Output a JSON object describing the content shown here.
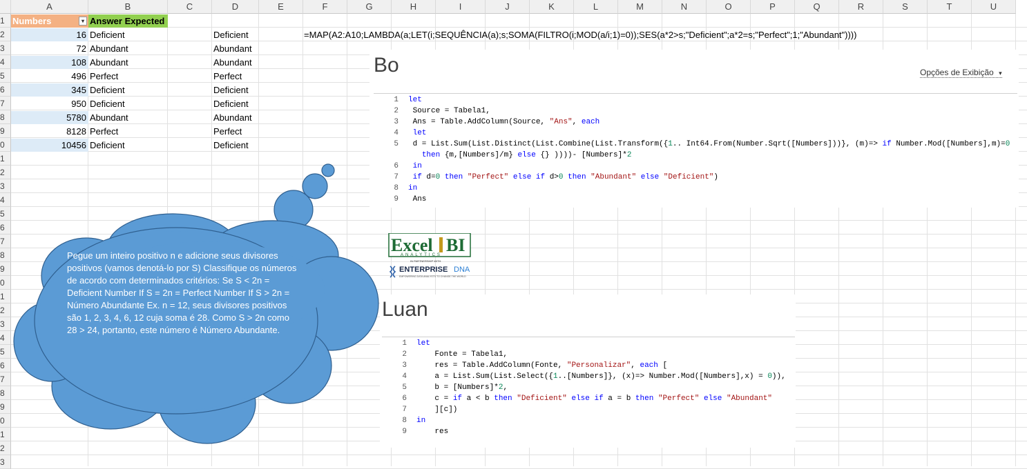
{
  "columns": [
    "A",
    "B",
    "C",
    "D",
    "E",
    "F",
    "G",
    "H",
    "I",
    "J",
    "K",
    "L",
    "M",
    "N",
    "O",
    "P",
    "Q",
    "R",
    "S",
    "T",
    "U"
  ],
  "rows": [
    "1",
    "2",
    "3",
    "4",
    "5",
    "6",
    "7",
    "8",
    "9",
    "0",
    "1",
    "2",
    "3",
    "4",
    "5",
    "6",
    "7",
    "8",
    "9",
    "0",
    "1",
    "2",
    "3",
    "4",
    "5",
    "6",
    "7",
    "8",
    "9",
    "0",
    "1",
    "2",
    "3"
  ],
  "table": {
    "header_a": "Numbers",
    "header_b": "Answer Expected",
    "filter_glyph": "▾",
    "rows": [
      {
        "n": "16",
        "b": "Deficient",
        "d": "Deficient"
      },
      {
        "n": "72",
        "b": "Abundant",
        "d": "Abundant"
      },
      {
        "n": "108",
        "b": "Abundant",
        "d": "Abundant"
      },
      {
        "n": "496",
        "b": "Perfect",
        "d": "Perfect"
      },
      {
        "n": "345",
        "b": "Deficient",
        "d": "Deficient"
      },
      {
        "n": "950",
        "b": "Deficient",
        "d": "Deficient"
      },
      {
        "n": "5780",
        "b": "Abundant",
        "d": "Abundant"
      },
      {
        "n": "8128",
        "b": "Perfect",
        "d": "Perfect"
      },
      {
        "n": "10456",
        "b": "Deficient",
        "d": "Deficient"
      }
    ]
  },
  "formula": "=MAP(A2:A10;LAMBDA(a;LET(i;SEQUÊNCIA(a);s;SOMA(FILTRO(i;MOD(a/i;1)=0));SES(a*2>s;\"Deficient\";a*2=s;\"Perfect\";1;\"Abundant\"))))",
  "panel1": {
    "title": "Bo",
    "options_label": "Opções de Exibição",
    "options_glyph": "▾"
  },
  "panel2": {
    "title": "Luan"
  },
  "cloud_text": "Pegue um inteiro positivo n e adicione seus divisores positivos (vamos denotá-lo por S) Classifique os números de acordo com determinados critérios: Se S < 2n = Deficient Number If S = 2n = Perfect Number If S > 2n = Número Abundante Ex. n = 12, seus divisores positivos são 1, 2, 3, 4, 6, 12 cuja soma é 28. Como S > 2n como 28 > 24, portanto, este número é Número Abundante.",
  "logo": {
    "excel": "Excel",
    "bi": "BI",
    "analytics": "ANALYTICS",
    "partnership": "IN PARTNERSHIP WITH",
    "enterprise": "ENTERPRISE",
    "dna": "DNA",
    "tagline": "EMPOWERING DATA ANALYSTS TO CHANGE THE WORLD"
  },
  "colors": {
    "header_orange": "#f4b183",
    "header_green": "#92d050",
    "band_blue": "#ddebf7",
    "cloud_fill": "#5b9bd5",
    "keyword_blue": "#0000ff",
    "string_red": "#a31515"
  }
}
